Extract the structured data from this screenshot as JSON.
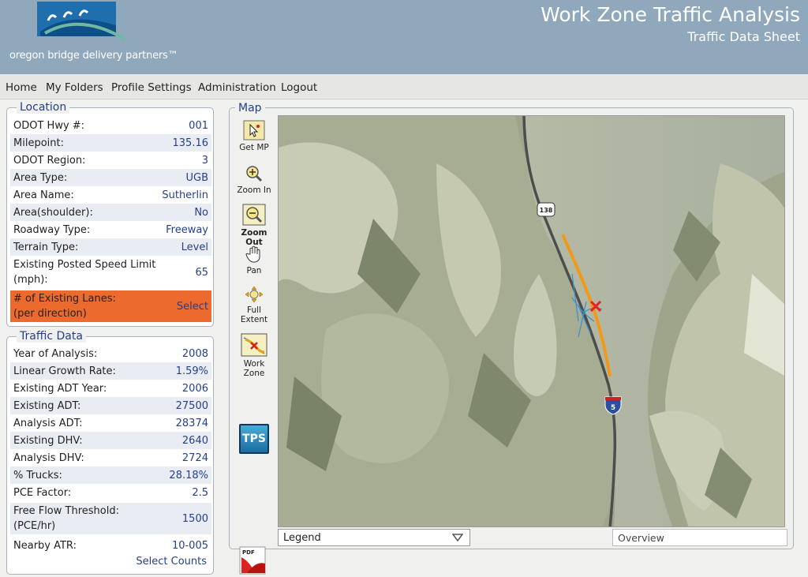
{
  "header": {
    "brand": "oregon bridge delivery partners™",
    "title": "Work Zone Traffic Analysis",
    "subtitle": "Traffic Data Sheet"
  },
  "nav": [
    "Home",
    "My Folders",
    "Profile Settings",
    "Administration",
    "Logout"
  ],
  "location": {
    "title": "Location",
    "rows": [
      {
        "label": "ODOT Hwy #:",
        "value": "001"
      },
      {
        "label": "Milepoint:",
        "value": "135.16"
      },
      {
        "label": "ODOT Region:",
        "value": "3"
      },
      {
        "label": "Area Type:",
        "value": "UGB"
      },
      {
        "label": "Area Name:",
        "value": "Sutherlin"
      },
      {
        "label": "Area(shoulder):",
        "value": "No"
      },
      {
        "label": "Roadway Type:",
        "value": "Freeway"
      },
      {
        "label": "Terrain Type:",
        "value": "Level"
      },
      {
        "label": "Existing Posted Speed Limit (mph):",
        "value": "65"
      },
      {
        "label": "# of Existing Lanes: (per direction)",
        "value": "Select"
      }
    ]
  },
  "traffic": {
    "title": "Traffic Data",
    "rows": [
      {
        "label": "Year of Analysis:",
        "value": "2008"
      },
      {
        "label": "Linear Growth Rate:",
        "value": "1.59%"
      },
      {
        "label": "Existing ADT Year:",
        "value": "2006"
      },
      {
        "label": "Existing ADT:",
        "value": "27500"
      },
      {
        "label": "Analysis ADT:",
        "value": "28374"
      },
      {
        "label": "Existing DHV:",
        "value": "2640"
      },
      {
        "label": "Analysis DHV:",
        "value": "2724"
      },
      {
        "label": "% Trucks:",
        "value": "28.18%"
      },
      {
        "label": "PCE Factor:",
        "value": "2.5"
      },
      {
        "label": "Free Flow Threshold: (PCE/hr)",
        "value": "1500"
      },
      {
        "label": "Nearby ATR:",
        "value": "10-005"
      }
    ],
    "select_counts": "Select Counts"
  },
  "map": {
    "title": "Map",
    "tools": {
      "get_mp": "Get MP",
      "zoom_in": "Zoom In",
      "zoom_out": "Zoom Out",
      "pan": "Pan",
      "full_extent": "Full Extent",
      "work_zone": "Work Zone"
    },
    "shield_138": "138",
    "shield_5": "5",
    "legend": "Legend",
    "overview": "Overview",
    "tps": "TPS",
    "pdf": "PDF"
  }
}
